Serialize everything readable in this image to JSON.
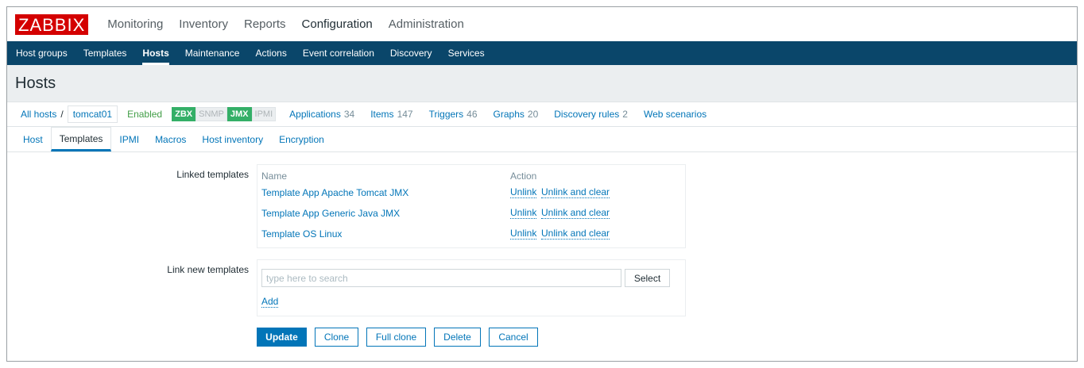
{
  "logo": "ZABBIX",
  "top_menu": [
    "Monitoring",
    "Inventory",
    "Reports",
    "Configuration",
    "Administration"
  ],
  "sub_menu": [
    "Host groups",
    "Templates",
    "Hosts",
    "Maintenance",
    "Actions",
    "Event correlation",
    "Discovery",
    "Services"
  ],
  "page_title": "Hosts",
  "host_nav": {
    "all_hosts": "All hosts",
    "separator": "/",
    "host": "tomcat01",
    "status": "Enabled",
    "availability": [
      "ZBX",
      "SNMP",
      "JMX",
      "IPMI"
    ],
    "applications": {
      "label": "Applications",
      "count": "34"
    },
    "items": {
      "label": "Items",
      "count": "147"
    },
    "triggers": {
      "label": "Triggers",
      "count": "46"
    },
    "graphs": {
      "label": "Graphs",
      "count": "20"
    },
    "discovery": {
      "label": "Discovery rules",
      "count": "2"
    },
    "web": {
      "label": "Web scenarios"
    }
  },
  "tabs": [
    "Host",
    "Templates",
    "IPMI",
    "Macros",
    "Host inventory",
    "Encryption"
  ],
  "form": {
    "linked_label": "Linked templates",
    "col_name": "Name",
    "col_action": "Action",
    "templates": [
      {
        "name": "Template App Apache Tomcat JMX",
        "unlink": "Unlink",
        "unlink_clear": "Unlink and clear"
      },
      {
        "name": "Template App Generic Java JMX",
        "unlink": "Unlink",
        "unlink_clear": "Unlink and clear"
      },
      {
        "name": "Template OS Linux",
        "unlink": "Unlink",
        "unlink_clear": "Unlink and clear"
      }
    ],
    "new_label": "Link new templates",
    "search_placeholder": "type here to search",
    "select": "Select",
    "add": "Add"
  },
  "buttons": {
    "update": "Update",
    "clone": "Clone",
    "full_clone": "Full clone",
    "delete": "Delete",
    "cancel": "Cancel"
  },
  "colors": {
    "brand_red": "#d40000",
    "nav_blue": "#0a466a",
    "link_blue": "#0275b8",
    "available_green": "#34af67"
  }
}
